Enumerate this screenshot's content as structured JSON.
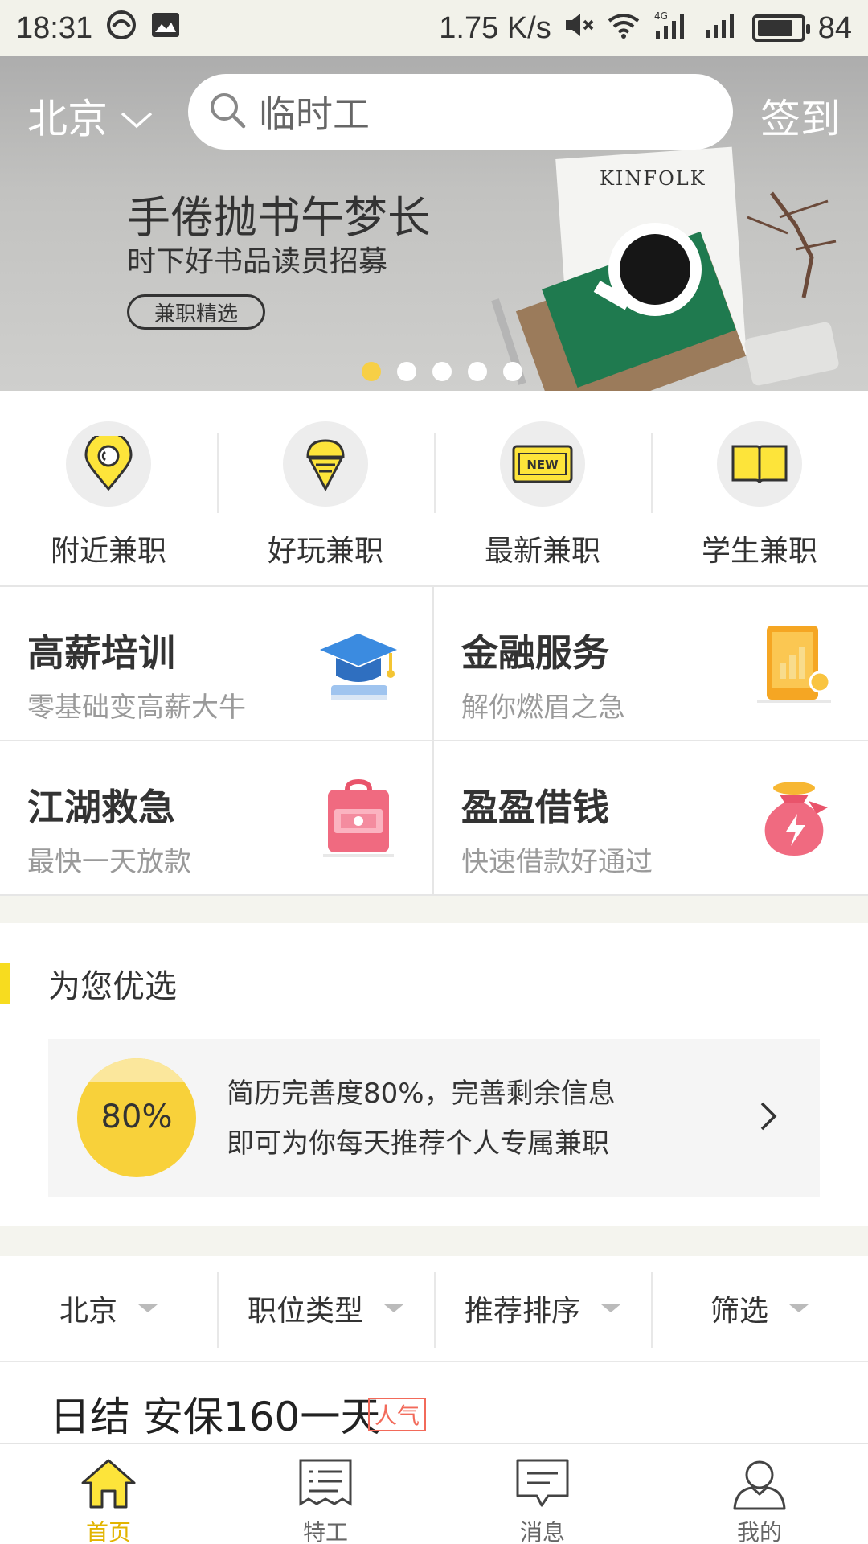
{
  "status_bar": {
    "time": "18:31",
    "network_speed": "1.75 K/s",
    "network_type": "4G",
    "battery_level": "84",
    "battery_fraction": 0.84
  },
  "header": {
    "city": "北京",
    "search_placeholder": "临时工",
    "checkin_label": "签到"
  },
  "banner": {
    "title": "手倦抛书午梦长",
    "subtitle": "时下好书品读员招募",
    "tag": "兼职精选",
    "slide_count": 5,
    "active_slide": 0,
    "image_text": "KINFOLK"
  },
  "categories": [
    {
      "label": "附近兼职",
      "icon": "location-pin-icon"
    },
    {
      "label": "好玩兼职",
      "icon": "ice-cream-icon"
    },
    {
      "label": "最新兼职",
      "icon": "new-ticket-icon",
      "badge": "NEW"
    },
    {
      "label": "学生兼职",
      "icon": "book-icon"
    }
  ],
  "services": [
    {
      "title": "高薪培训",
      "subtitle": "零基础变高薪大牛",
      "icon": "graduation-cap-icon"
    },
    {
      "title": "金融服务",
      "subtitle": "解你燃眉之急",
      "icon": "tablet-chart-icon"
    },
    {
      "title": "江湖救急",
      "subtitle": "最快一天放款",
      "icon": "cash-box-icon"
    },
    {
      "title": "盈盈借钱",
      "subtitle": "快速借款好通过",
      "icon": "money-bag-icon"
    }
  ],
  "recommend": {
    "section_title": "为您优选",
    "progress_text": "80%",
    "progress_fraction": 0.8,
    "line1": "简历完善度80%，完善剩余信息",
    "line2": "即可为你每天推荐个人专属兼职"
  },
  "filters": [
    "北京",
    "职位类型",
    "推荐排序",
    "筛选"
  ],
  "job_preview": {
    "title": "日结 安保160一天",
    "tag": "人气"
  },
  "bottom_nav": [
    {
      "label": "首页",
      "icon": "home-icon",
      "active": true
    },
    {
      "label": "特工",
      "icon": "list-icon",
      "active": false
    },
    {
      "label": "消息",
      "icon": "message-icon",
      "active": false
    },
    {
      "label": "我的",
      "icon": "profile-icon",
      "active": false
    }
  ],
  "colors": {
    "accent_yellow": "#f7dc1f",
    "active_nav": "#e2b400",
    "hot_tag": "#f26a5a"
  }
}
